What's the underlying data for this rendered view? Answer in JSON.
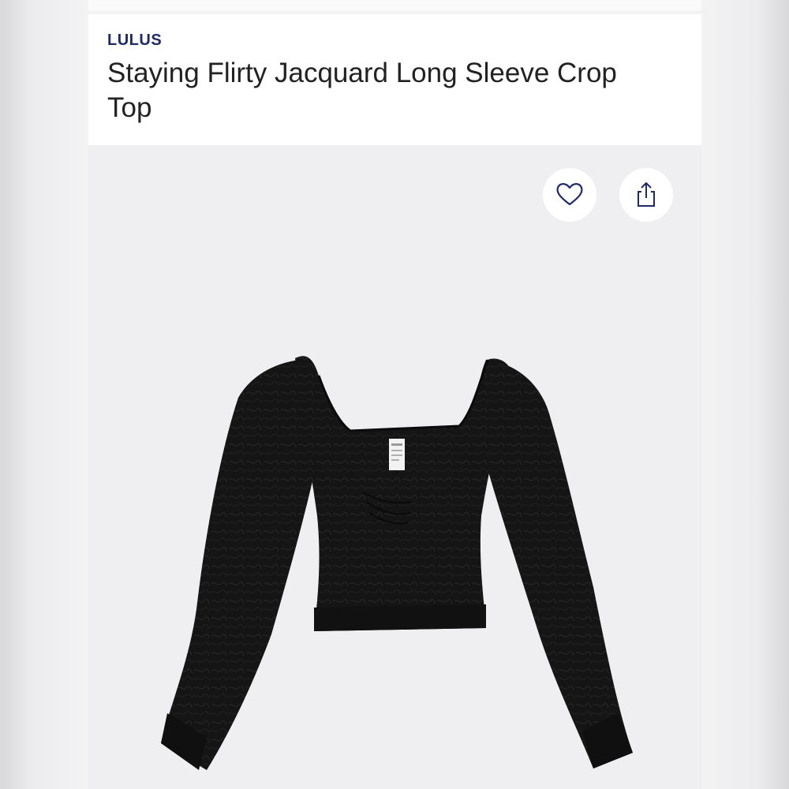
{
  "product": {
    "brand": "LULUS",
    "title": "Staying Flirty Jacquard Long Sleeve Crop Top"
  },
  "actions": {
    "favorite_icon": "heart-icon",
    "share_icon": "share-icon"
  },
  "colors": {
    "brand_text": "#1f2a6b",
    "title_text": "#222222",
    "photo_bg": "#efeff1",
    "garment": "#141414"
  }
}
